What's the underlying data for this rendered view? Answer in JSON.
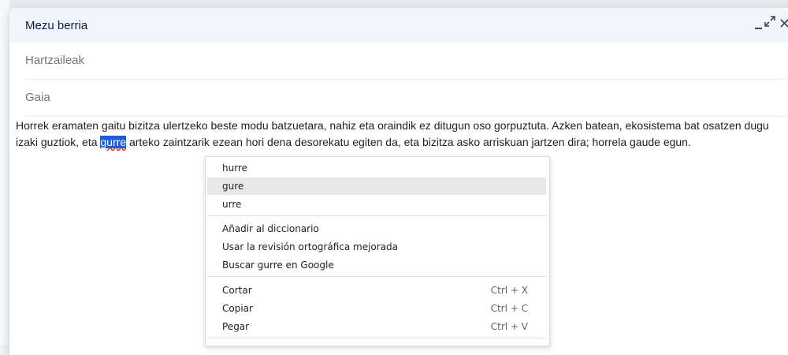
{
  "compose": {
    "title": "Mezu berria",
    "controls": {
      "minimize": "minimize",
      "expand": "exit-full-screen",
      "close": "close"
    },
    "recipients_placeholder": "Hartzaileak",
    "subject_placeholder": "Gaia",
    "body": {
      "before": "Horrek eramaten gaitu bizitza ulertzeko beste modu batzuetara, nahiz eta oraindik ez ditugun oso gorpuztuta. Azken batean, ekosistema bat osatzen dugu izaki guztiok, eta ",
      "misspelled_word": "gurre",
      "after": " arteko zaintzarik ezean hori dena desorekatu egiten da, eta bizitza asko arriskuan jartzen dira; horrela gaude egun."
    }
  },
  "context_menu": {
    "suggestions": [
      "hurre",
      "gure",
      "urre"
    ],
    "spell_actions": [
      "Añadir al diccionario",
      "Usar la revisión ortográfica mejorada",
      "Buscar gurre en Google"
    ],
    "edit_actions": [
      {
        "label": "Cortar",
        "shortcut": "Ctrl + X"
      },
      {
        "label": "Copiar",
        "shortcut": "Ctrl + C"
      },
      {
        "label": "Pegar",
        "shortcut": "Ctrl + V"
      }
    ],
    "highlighted_item": "gure"
  },
  "colors": {
    "header_bg": "#f2f6fc",
    "selection_bg": "#1a5fd6",
    "menu_hover": "#e8e8e8"
  }
}
